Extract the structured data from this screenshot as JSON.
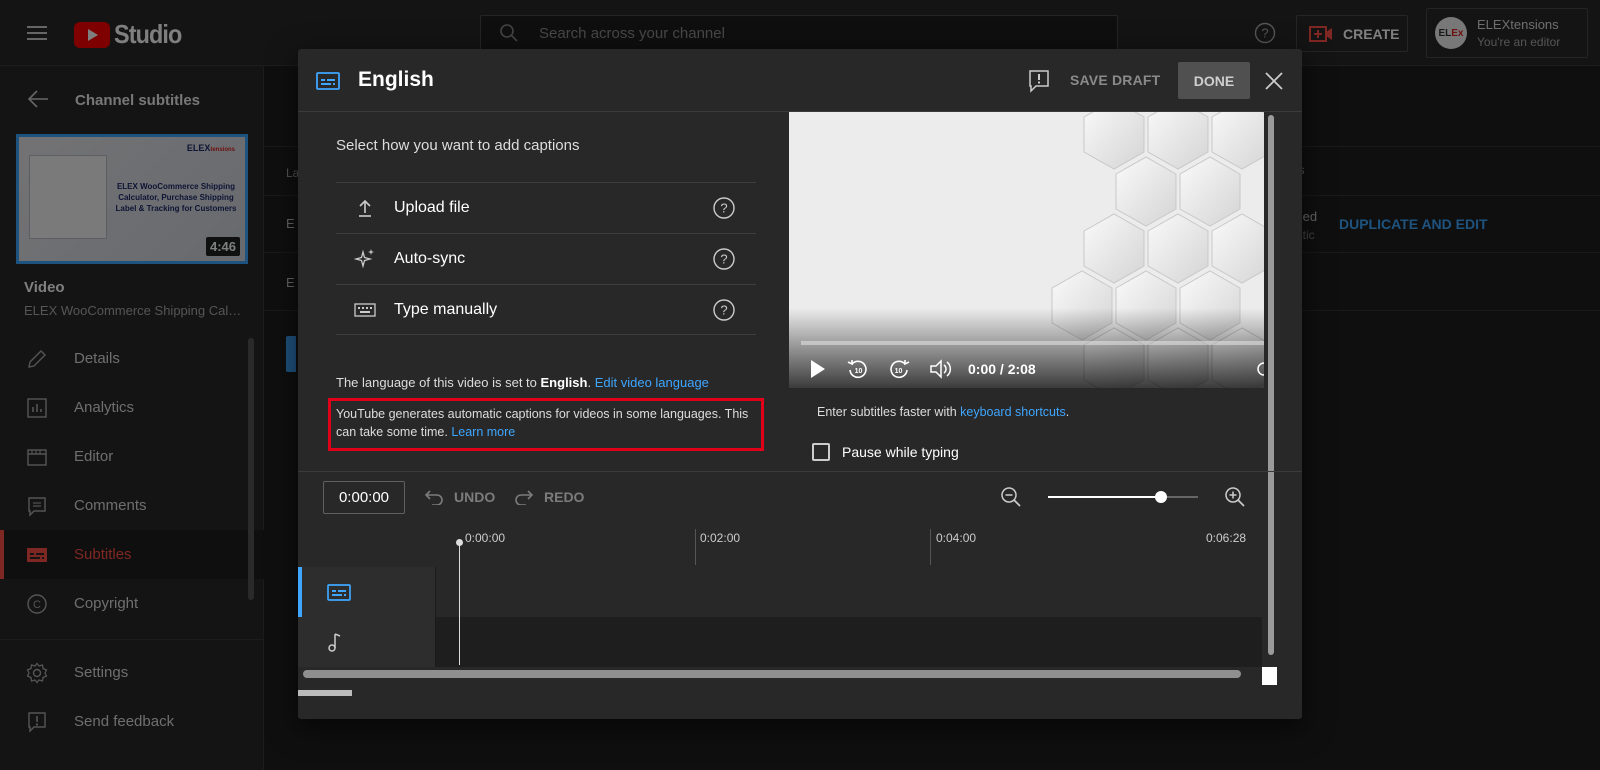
{
  "topbar": {
    "logo_text": "Studio",
    "search_placeholder": "Search across your channel",
    "create_label": "CREATE",
    "account_name": "ELEXtensions",
    "account_role": "You're an editor",
    "avatar_text": "EL",
    "avatar_accent": "Ex"
  },
  "sidebar": {
    "title": "Channel subtitles",
    "thumbnail": {
      "logo": "ELEX",
      "logo_accent": "tensions",
      "title": "ELEX WooCommerce Shipping Calculator, Purchase Shipping Label & Tracking for Customers",
      "duration": "4:46"
    },
    "video_label": "Video",
    "video_title": "ELEX WooCommerce Shipping Calc...",
    "nav": [
      {
        "label": "Details",
        "icon": "pencil-icon"
      },
      {
        "label": "Analytics",
        "icon": "analytics-icon"
      },
      {
        "label": "Editor",
        "icon": "editor-icon"
      },
      {
        "label": "Comments",
        "icon": "comments-icon"
      },
      {
        "label": "Subtitles",
        "icon": "subtitles-icon",
        "active": true
      },
      {
        "label": "Copyright",
        "icon": "copyright-icon"
      }
    ],
    "bottom_nav": [
      {
        "label": "Settings",
        "icon": "gear-icon"
      },
      {
        "label": "Send feedback",
        "icon": "feedback-icon"
      }
    ]
  },
  "background": {
    "col_header_l": "La",
    "col_header_r": "tles",
    "row1_e": "E",
    "row2_e": "E",
    "published": "ished",
    "automatic": "matic",
    "duplicate_label": "DUPLICATE AND EDIT"
  },
  "modal": {
    "title": "English",
    "save_draft_label": "SAVE DRAFT",
    "done_label": "DONE",
    "heading": "Select how you want to add captions",
    "options": [
      {
        "label": "Upload file",
        "icon": "upload-icon"
      },
      {
        "label": "Auto-sync",
        "icon": "sparkle-icon"
      },
      {
        "label": "Type manually",
        "icon": "keyboard-icon"
      }
    ],
    "language_prefix": "The language of this video is set to ",
    "language_name": "English",
    "language_suffix": ". ",
    "edit_language_link": "Edit video language",
    "auto_captions_text": "YouTube generates automatic captions for videos in some languages. This can take some time. ",
    "learn_more_link": "Learn more",
    "video_time": "0:00 / 2:08",
    "kbd_prefix": "Enter subtitles faster with ",
    "kbd_link": "keyboard shortcuts",
    "kbd_suffix": ".",
    "pause_label": "Pause while typing",
    "time_input_value": "0:00:00",
    "undo_label": "UNDO",
    "redo_label": "REDO",
    "zoom_level": 0.75,
    "ruler": [
      "0:00:00",
      "0:02:00",
      "0:04:00",
      "0:06:28"
    ]
  },
  "colors": {
    "accent_blue": "#3ea6ff",
    "brand_red": "#ff0000",
    "active_red": "#ff4e45",
    "highlight_box": "#e0001a"
  }
}
